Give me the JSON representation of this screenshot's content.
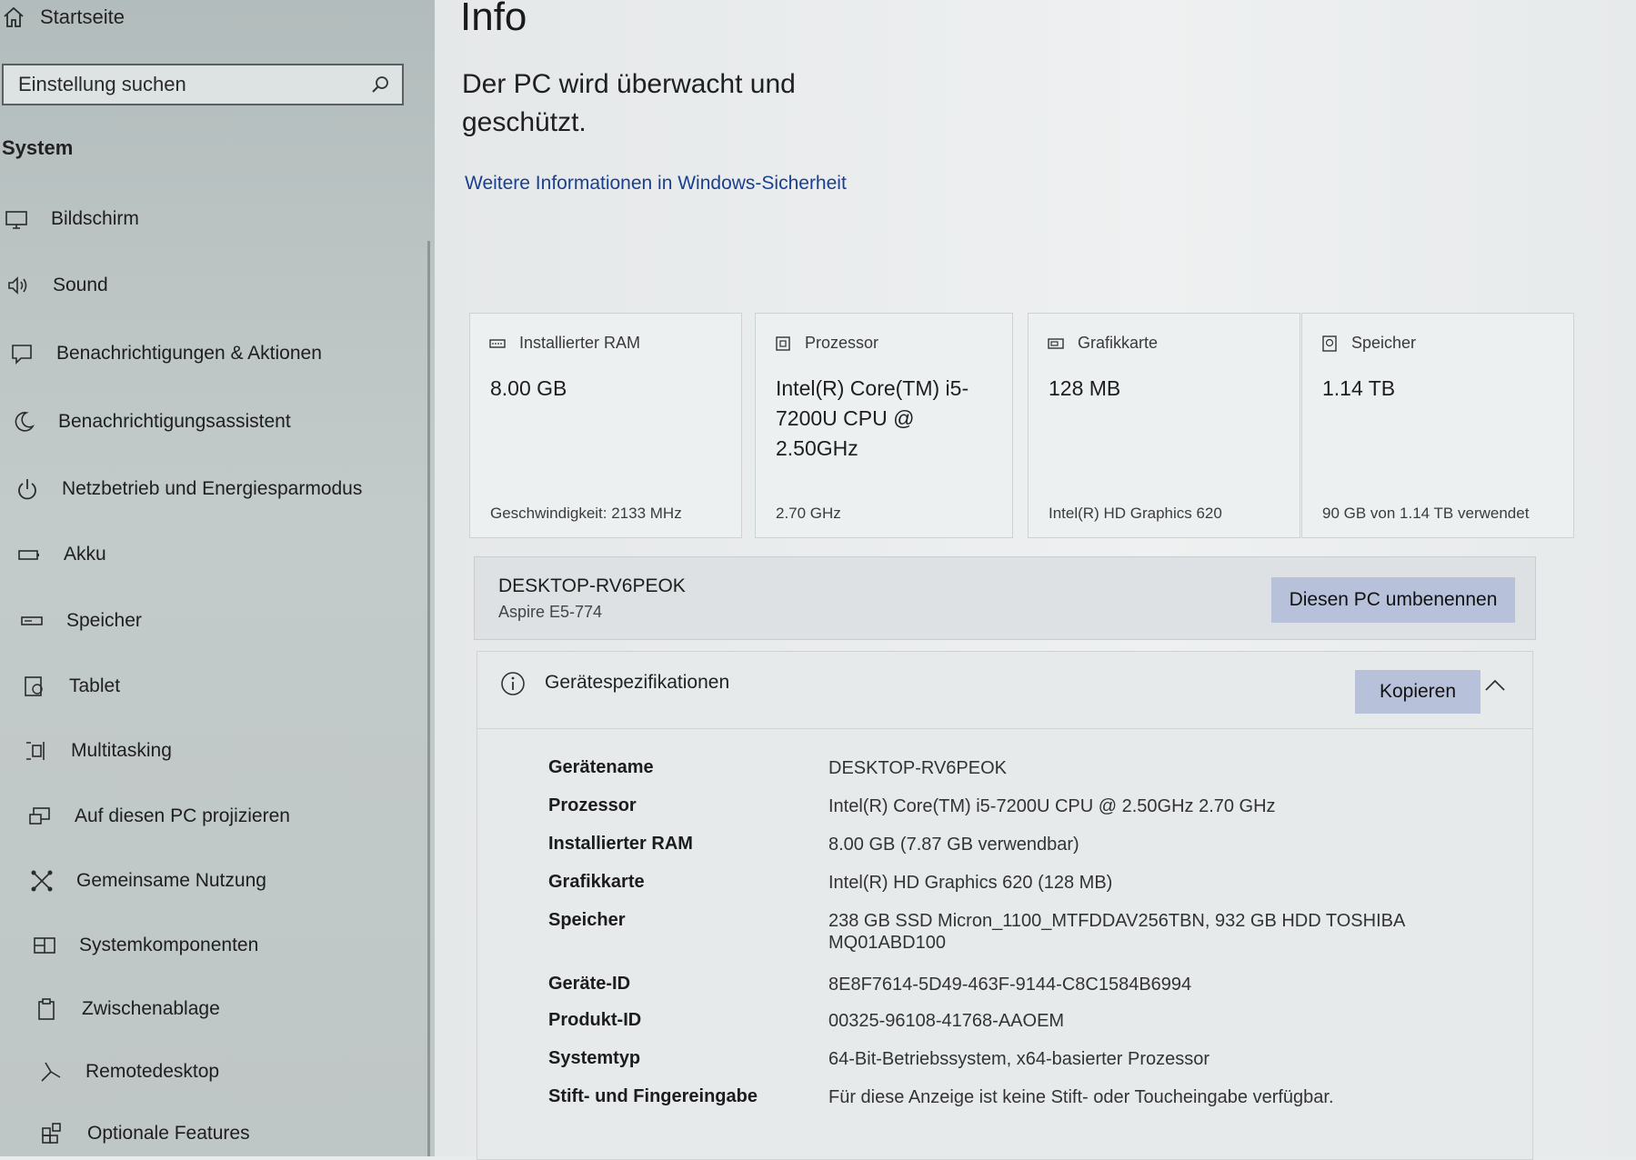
{
  "sidebar": {
    "home_label": "Startseite",
    "search_placeholder": "Einstellung suchen",
    "section_title": "System",
    "items": [
      {
        "label": "Bildschirm",
        "icon": "monitor-icon"
      },
      {
        "label": "Sound",
        "icon": "speaker-icon"
      },
      {
        "label": "Benachrichtigungen & Aktionen",
        "icon": "notification-icon"
      },
      {
        "label": "Benachrichtigungsassistent",
        "icon": "moon-icon"
      },
      {
        "label": "Netzbetrieb und Energiesparmodus",
        "icon": "power-icon"
      },
      {
        "label": "Akku",
        "icon": "battery-icon"
      },
      {
        "label": "Speicher",
        "icon": "storage-icon"
      },
      {
        "label": "Tablet",
        "icon": "tablet-icon"
      },
      {
        "label": "Multitasking",
        "icon": "multitasking-icon"
      },
      {
        "label": "Auf diesen PC projizieren",
        "icon": "project-icon"
      },
      {
        "label": "Gemeinsame Nutzung",
        "icon": "share-icon"
      },
      {
        "label": "Systemkomponenten",
        "icon": "components-icon"
      },
      {
        "label": "Zwischenablage",
        "icon": "clipboard-icon"
      },
      {
        "label": "Remotedesktop",
        "icon": "remote-desktop-icon"
      },
      {
        "label": "Optionale Features",
        "icon": "features-icon"
      }
    ]
  },
  "main": {
    "title": "Info",
    "protect_text": "Der PC wird überwacht und geschützt.",
    "security_link": "Weitere Informationen in Windows-Sicherheit",
    "cards": [
      {
        "label": "Installierter RAM",
        "value": "8.00 GB",
        "sub": "Geschwindigkeit: 2133 MHz",
        "icon": "ram-icon"
      },
      {
        "label": "Prozessor",
        "value": "Intel(R) Core(TM) i5-7200U CPU @ 2.50GHz",
        "sub": "2.70 GHz",
        "icon": "cpu-icon"
      },
      {
        "label": "Grafikkarte",
        "value": "128 MB",
        "sub": "Intel(R) HD Graphics 620",
        "icon": "gpu-icon"
      },
      {
        "label": "Speicher",
        "value": "1.14 TB",
        "sub": "90 GB von 1.14 TB verwendet",
        "icon": "disk-icon"
      }
    ],
    "pc_name": "DESKTOP-RV6PEOK",
    "pc_model": "Aspire E5-774",
    "rename_button": "Diesen PC umbenennen",
    "specs_title": "Gerätespezifikationen",
    "copy_button": "Kopieren",
    "specs": [
      {
        "key": "Gerätename",
        "value": "DESKTOP-RV6PEOK"
      },
      {
        "key": "Prozessor",
        "value": "Intel(R) Core(TM) i5-7200U CPU @ 2.50GHz   2.70 GHz"
      },
      {
        "key": "Installierter RAM",
        "value": "8.00 GB (7.87 GB verwendbar)"
      },
      {
        "key": "Grafikkarte",
        "value": "Intel(R) HD Graphics 620 (128 MB)"
      },
      {
        "key": "Speicher",
        "value": "238 GB SSD Micron_1100_MTFDDAV256TBN, 932 GB HDD TOSHIBA MQ01ABD100"
      },
      {
        "key": "Geräte-ID",
        "value": "8E8F7614-5D49-463F-9144-C8C1584B6994"
      },
      {
        "key": "Produkt-ID",
        "value": "00325-96108-41768-AAOEM"
      },
      {
        "key": "Systemtyp",
        "value": "64-Bit-Betriebssystem, x64-basierter Prozessor"
      },
      {
        "key": "Stift- und Fingereingabe",
        "value": "Für diese Anzeige ist keine Stift- oder Toucheingabe verfügbar."
      }
    ]
  }
}
